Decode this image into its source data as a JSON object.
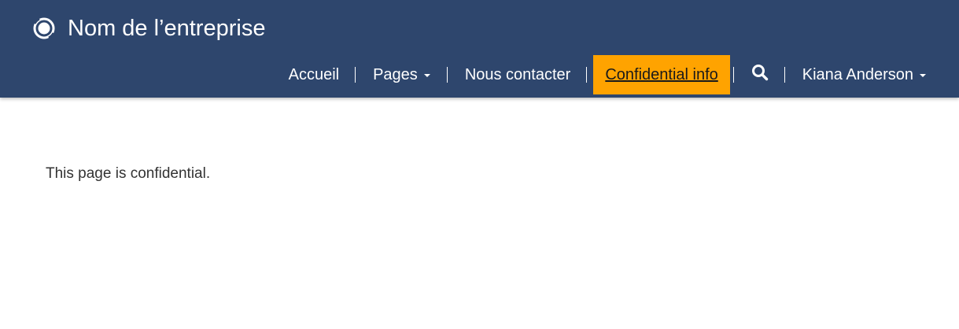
{
  "header": {
    "company_name": "Nom de l’entreprise",
    "logo_icon": "company-logo-icon",
    "background_color": "#2e466d"
  },
  "nav": {
    "items": [
      {
        "label": "Accueil"
      },
      {
        "label": "Pages",
        "has_dropdown": true
      },
      {
        "label": "Nous contacter"
      },
      {
        "label": "Confidential info",
        "active": true,
        "highlight_color": "#ffa300"
      },
      {
        "icon": "search-icon"
      },
      {
        "label": "Kiana Anderson",
        "has_dropdown": true
      }
    ]
  },
  "main": {
    "text": "This page is confidential."
  }
}
